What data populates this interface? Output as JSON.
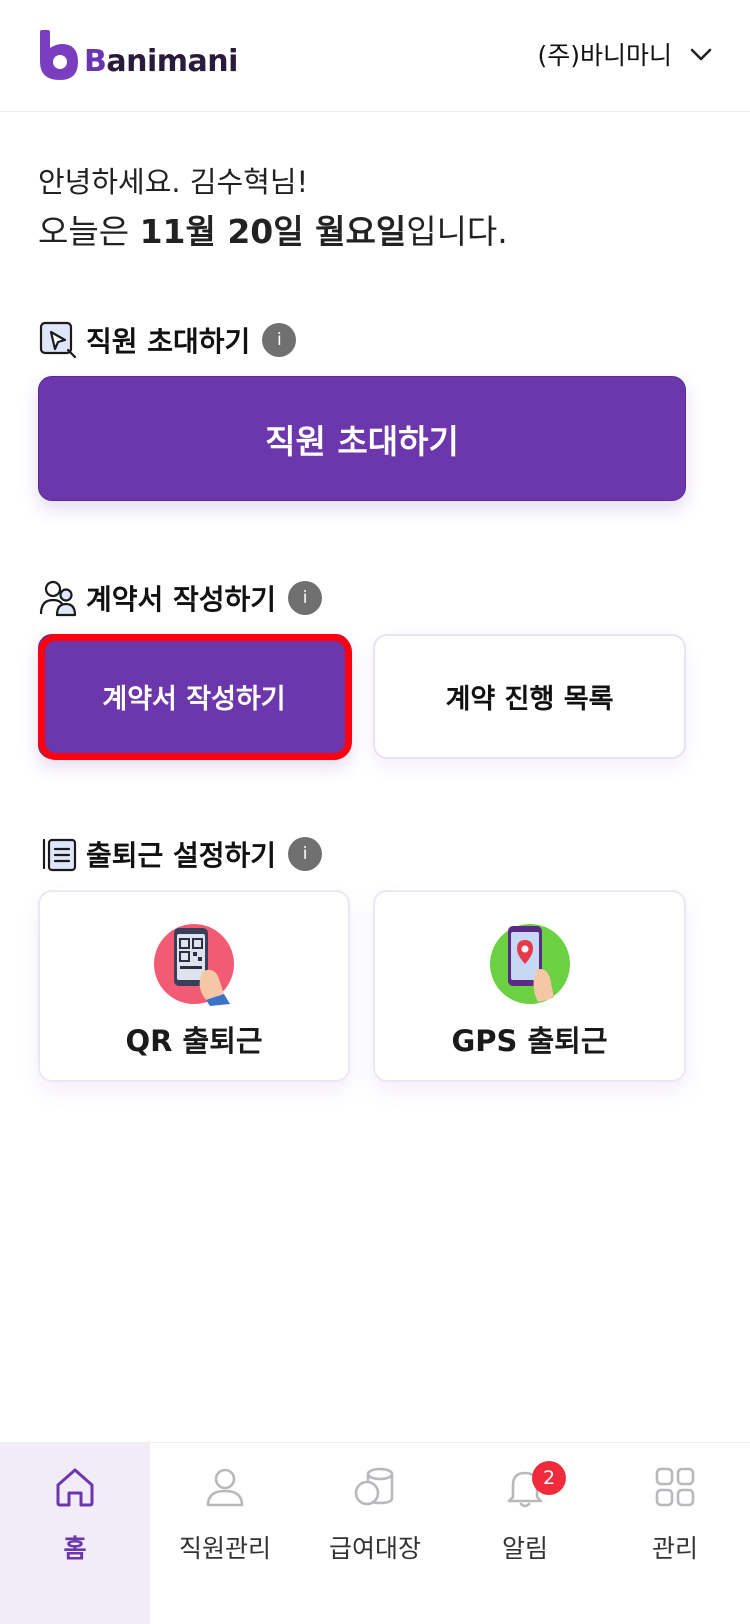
{
  "header": {
    "logo_text_b": "B",
    "logo_text_rest": "animani",
    "company": "(주)바니마니"
  },
  "greeting": {
    "line1": "안녕하세요. 김수혁님!",
    "line2_prefix": "오늘은 ",
    "line2_date": "11월 20일 월요일",
    "line2_suffix": "입니다."
  },
  "sections": {
    "invite": {
      "title": "직원 초대하기",
      "info": "i",
      "button": "직원 초대하기"
    },
    "contract": {
      "title": "계약서 작성하기",
      "info": "i",
      "primary_button": "계약서 작성하기",
      "secondary_button": "계약 진행 목록"
    },
    "attendance": {
      "title": "출퇴근 설정하기",
      "info": "i",
      "qr_label": "QR 출퇴근",
      "gps_label": "GPS 출퇴근"
    }
  },
  "bottom_nav": {
    "items": [
      {
        "label": "홈",
        "icon": "home-icon",
        "active": true
      },
      {
        "label": "직원관리",
        "icon": "user-icon"
      },
      {
        "label": "급여대장",
        "icon": "coins-icon"
      },
      {
        "label": "알림",
        "icon": "bell-icon",
        "badge": "2"
      },
      {
        "label": "관리",
        "icon": "grid-icon"
      }
    ]
  },
  "colors": {
    "brand": "#6c37ad",
    "highlight": "#ff0010",
    "badge": "#f02c3c"
  }
}
